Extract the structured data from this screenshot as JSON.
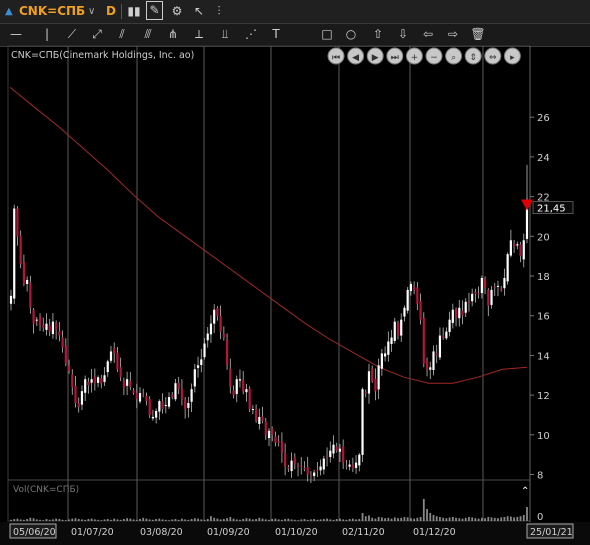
{
  "toolbar": {
    "symbol": "CNK=СПБ",
    "period": "D",
    "tool_icons": [
      "candles-icon",
      "draw-pen-icon",
      "chart-settings-icon",
      "cursor-icon",
      "indicators-icon"
    ],
    "draw_icons": [
      "horizontal-line-icon",
      "vertical-line-icon",
      "trend-line-icon",
      "ray-icon",
      "channel-icon",
      "fibonacci-icon",
      "pitchfork-icon",
      "gann-fan-icon",
      "regression-icon",
      "text-icon",
      "rectangle-icon",
      "ellipse-icon",
      "arrow-up-icon",
      "arrow-down-icon",
      "arrow-left-icon",
      "arrow-right-icon",
      "trash-icon"
    ]
  },
  "colors": {
    "background": "#000000",
    "up_candle": "#ffffff",
    "down_candle": "#b0183a",
    "moving_average": "#a02828",
    "grid": "#5a5a5a",
    "marker": "#e00000",
    "volume": "#888888"
  },
  "chart_data": {
    "type": "candlestick",
    "title": "CNK=СПБ(Cinemark Holdings, Inc. ao)",
    "volume_label": "Vol(CNK=СПБ)",
    "x_labels": [
      "05/06/20",
      "01/07/20",
      "03/08/20",
      "01/09/20",
      "01/10/20",
      "02/11/20",
      "01/12/20",
      "25/01/21"
    ],
    "x_range": [
      "05/06/20",
      "25/01/21"
    ],
    "y_ticks": [
      8,
      10,
      12,
      14,
      16,
      18,
      20,
      22,
      24,
      26
    ],
    "y_range": [
      7,
      28
    ],
    "last_price": "21.45",
    "last_price_label": "21,45",
    "sessions": 161,
    "series": [
      {
        "name": "Close",
        "values": [
          17.0,
          21.4,
          20.0,
          18.6,
          17.6,
          17.8,
          16.4,
          15.6,
          15.8,
          15.5,
          15.4,
          15.6,
          15.2,
          15.7,
          15.3,
          15.0,
          14.4,
          13.6,
          13.2,
          12.4,
          11.6,
          11.4,
          12.2,
          12.8,
          12.5,
          12.8,
          12.6,
          12.9,
          12.6,
          13.0,
          13.7,
          14.2,
          14.1,
          13.3,
          12.9,
          12.4,
          12.8,
          12.4,
          12.1,
          11.8,
          12.1,
          12.0,
          11.7,
          11.0,
          10.9,
          11.2,
          11.7,
          11.3,
          11.5,
          11.9,
          11.9,
          12.6,
          12.3,
          11.8,
          11.3,
          11.6,
          12.3,
          13.3,
          13.5,
          13.8,
          14.6,
          15.1,
          15.6,
          16.3,
          16.0,
          15.2,
          14.9,
          13.5,
          12.4,
          12.0,
          12.8,
          12.8,
          12.2,
          12.3,
          11.3,
          11.3,
          10.7,
          10.9,
          10.7,
          10.0,
          10.2,
          10.0,
          9.6,
          9.6,
          9.1,
          8.4,
          8.3,
          8.7,
          8.5,
          8.4,
          8.4,
          8.3,
          8.0,
          7.9,
          8.1,
          8.2,
          8.4,
          8.8,
          8.9,
          9.2,
          9.5,
          9.2,
          9.3,
          8.6,
          8.4,
          8.5,
          8.3,
          8.6,
          9.0,
          12.3,
          12.1,
          13.2,
          12.7,
          12.2,
          13.5,
          14.1,
          14.1,
          14.7,
          14.9,
          15.7,
          15.0,
          15.8,
          16.4,
          17.3,
          17.6,
          17.3,
          16.6,
          15.8,
          13.6,
          13.3,
          13.4,
          14.2,
          14.0,
          15.0,
          14.9,
          15.2,
          15.8,
          16.3,
          15.9,
          16.4,
          16.0,
          16.7,
          16.6,
          17.1,
          17.1,
          17.1,
          17.9,
          17.4,
          16.5,
          17.3,
          17.4,
          17.5,
          17.3,
          17.9,
          19.1,
          19.8,
          19.5,
          19.6,
          19.0,
          19.8,
          21.45
        ]
      },
      {
        "name": "MA",
        "values": [
          27.5,
          26.5,
          25.5,
          24.4,
          23.3,
          22.1,
          21.0,
          20.1,
          19.2,
          18.3,
          17.4,
          16.5,
          15.6,
          14.8,
          14.1,
          13.4,
          12.9,
          12.6,
          12.6,
          12.9,
          13.3,
          13.4
        ]
      }
    ],
    "volume": {
      "y_ticks": [
        0
      ],
      "values": [
        0.03,
        0.05,
        0.06,
        0.04,
        0.03,
        0.05,
        0.08,
        0.07,
        0.04,
        0.03,
        0.02,
        0.05,
        0.03,
        0.04,
        0.06,
        0.05,
        0.03,
        0.02,
        0.04,
        0.06,
        0.07,
        0.05,
        0.04,
        0.03,
        0.05,
        0.06,
        0.04,
        0.03,
        0.02,
        0.04,
        0.05,
        0.03,
        0.06,
        0.04,
        0.03,
        0.05,
        0.07,
        0.06,
        0.04,
        0.03,
        0.05,
        0.08,
        0.06,
        0.04,
        0.03,
        0.05,
        0.06,
        0.04,
        0.03,
        0.02,
        0.04,
        0.05,
        0.03,
        0.06,
        0.04,
        0.03,
        0.05,
        0.07,
        0.06,
        0.04,
        0.03,
        0.05,
        0.12,
        0.08,
        0.06,
        0.04,
        0.05,
        0.07,
        0.1,
        0.06,
        0.04,
        0.03,
        0.05,
        0.07,
        0.06,
        0.04,
        0.05,
        0.08,
        0.06,
        0.04,
        0.03,
        0.05,
        0.06,
        0.04,
        0.03,
        0.05,
        0.06,
        0.04,
        0.03,
        0.02,
        0.04,
        0.05,
        0.03,
        0.04,
        0.05,
        0.03,
        0.04,
        0.05,
        0.06,
        0.04,
        0.03,
        0.05,
        0.06,
        0.04,
        0.03,
        0.05,
        0.06,
        0.04,
        0.05,
        0.2,
        0.12,
        0.14,
        0.08,
        0.06,
        0.1,
        0.09,
        0.07,
        0.08,
        0.06,
        0.09,
        0.07,
        0.08,
        0.1,
        0.09,
        0.07,
        0.06,
        0.08,
        0.1,
        0.55,
        0.3,
        0.2,
        0.15,
        0.12,
        0.1,
        0.08,
        0.07,
        0.09,
        0.1,
        0.08,
        0.07,
        0.06,
        0.08,
        0.1,
        0.09,
        0.07,
        0.06,
        0.08,
        0.07,
        0.1,
        0.09,
        0.08,
        0.07,
        0.09,
        0.1,
        0.12,
        0.11,
        0.09,
        0.1,
        0.12,
        0.15,
        0.35
      ]
    }
  }
}
